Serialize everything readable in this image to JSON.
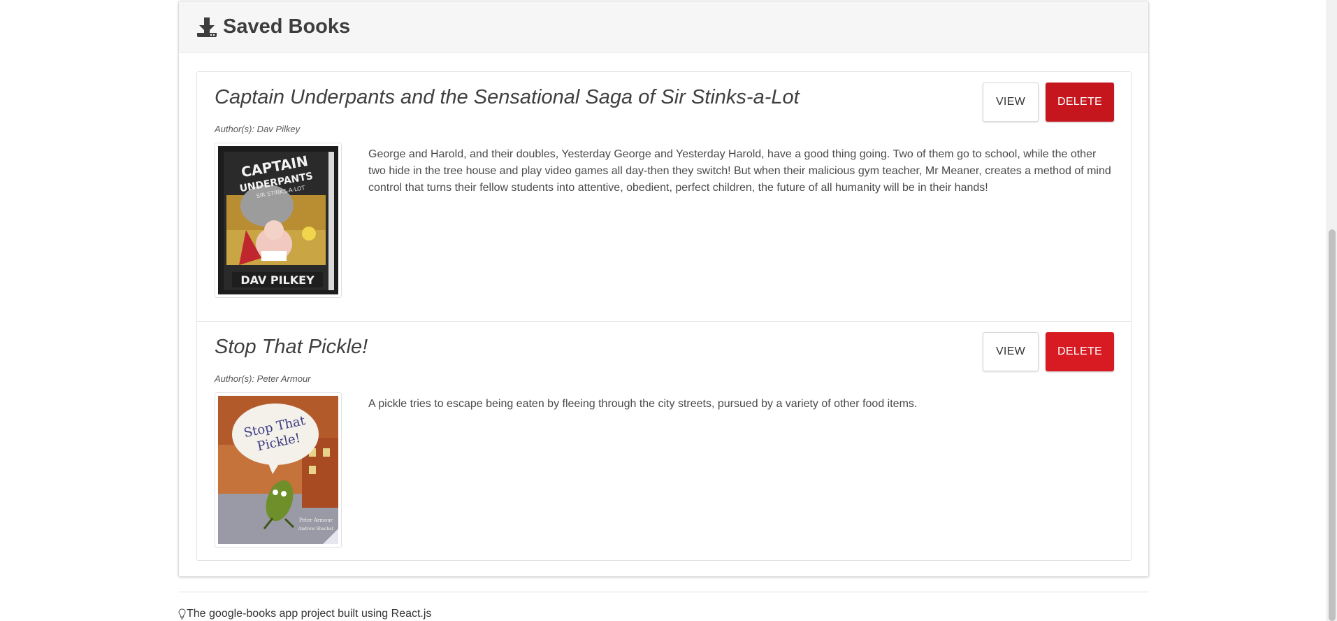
{
  "panel": {
    "title": "Saved Books",
    "icon": "download-icon"
  },
  "books": [
    {
      "title": "Captain Underpants and the Sensational Saga of Sir Stinks-a-Lot",
      "authors": "Author(s): Dav Pilkey",
      "description": "George and Harold, and their doubles, Yesterday George and Yesterday Harold, have a good thing going. Two of them go to school, while the other two hide in the tree house and play video games all day-then they switch! But when their malicious gym teacher, Mr Meaner, creates a method of mind control that turns their fellow students into attentive, obedient, perfect children, the future of all humanity will be in their hands!",
      "view_label": "VIEW",
      "delete_label": "DELETE",
      "cover_text": [
        "CAPTAIN",
        "UNDERPANTS",
        "SIR STINKS-A-LOT",
        "DAV PILKEY"
      ]
    },
    {
      "title": "Stop That Pickle!",
      "authors": "Author(s): Peter Armour",
      "description": "A pickle tries to escape being eaten by fleeing through the city streets, pursued by a variety of other food items.",
      "view_label": "VIEW",
      "delete_label": "DELETE",
      "cover_text": [
        "Stop That",
        "Pickle!",
        "Peter Armour",
        "Andrew Shachat"
      ]
    }
  ],
  "footer": {
    "text": "The google-books app project built using React.js",
    "icon": "lightbulb-icon"
  },
  "colors": {
    "delete_button": "#c5161d",
    "header_bg": "#f6f6f6"
  }
}
